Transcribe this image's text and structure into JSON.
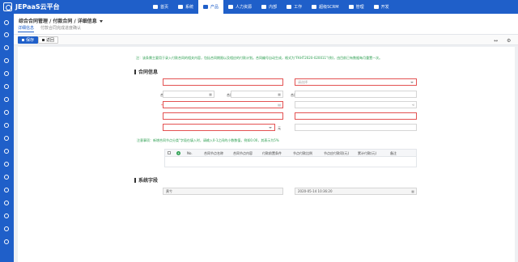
{
  "app": {
    "title": "JEPaaS云平台"
  },
  "nav": {
    "items": [
      {
        "label": "首页",
        "active": false
      },
      {
        "label": "系统",
        "active": false
      },
      {
        "label": "产品",
        "active": true
      },
      {
        "label": "人力资源",
        "active": false
      },
      {
        "label": "内部",
        "active": false
      },
      {
        "label": "工作",
        "active": false
      },
      {
        "label": "超级SCRM",
        "active": false
      },
      {
        "label": "管理",
        "active": false
      },
      {
        "label": "开发",
        "active": false
      }
    ]
  },
  "header": {
    "title": "综合合同管理 / 付款合同 / 详细信息",
    "tabs": [
      {
        "label": "详细信息",
        "active": true
      },
      {
        "label": "付款合同完成进度确认",
        "active": false
      }
    ]
  },
  "toolbar": {
    "save_label": "保存",
    "back_label": "返回"
  },
  "notice": "注：该条需主要用于录入付款合同的相关内容，包括合同期限以及相应的付款计划。合同编号自动生成，格式为\"FKHT2020-020011\"(例)，由目前已有数据每月重置一次。",
  "contract": {
    "section_title": "合同信息",
    "fields": {
      "name_label": "合同名称",
      "type_label": "合同类型",
      "type_placeholder": "请选择",
      "start_label": "合同开始日期",
      "end_label": "合同结束日期",
      "days_label": "合同天数（天）",
      "staff_label": "相关业务员",
      "dept_label": "相关部门",
      "partya_label": "合同甲方",
      "partyb_label": "合同乙方",
      "amount_label": "合同金额",
      "amount_unit": "元",
      "upper_label": "金额大写"
    }
  },
  "notice2": "注意事项：新增合同节点分类\"字段在填入时，请输入0-1之间的小数数值，例如0.00，其表示为5%",
  "grid": {
    "label": "合同明细",
    "headers": [
      "No.",
      "合同节点名称",
      "合同节点内容",
      "付款前置条件",
      "节点付款比例",
      "节点应付款项(元)",
      "累计付款(元)",
      "备注"
    ]
  },
  "system": {
    "section_title": "系统字段",
    "creator_label": "登记人",
    "creator_value": "黄兮",
    "time_label": "登记时间",
    "time_value": "2020-05-14 10:36:20"
  },
  "icons": {
    "calendar": "calendar-icon",
    "share": "share-icon",
    "dropdown": "chevron-down-icon"
  },
  "colors": {
    "brand": "#1f5fc9",
    "error": "#e35252",
    "notice": "#2b9e4f"
  }
}
